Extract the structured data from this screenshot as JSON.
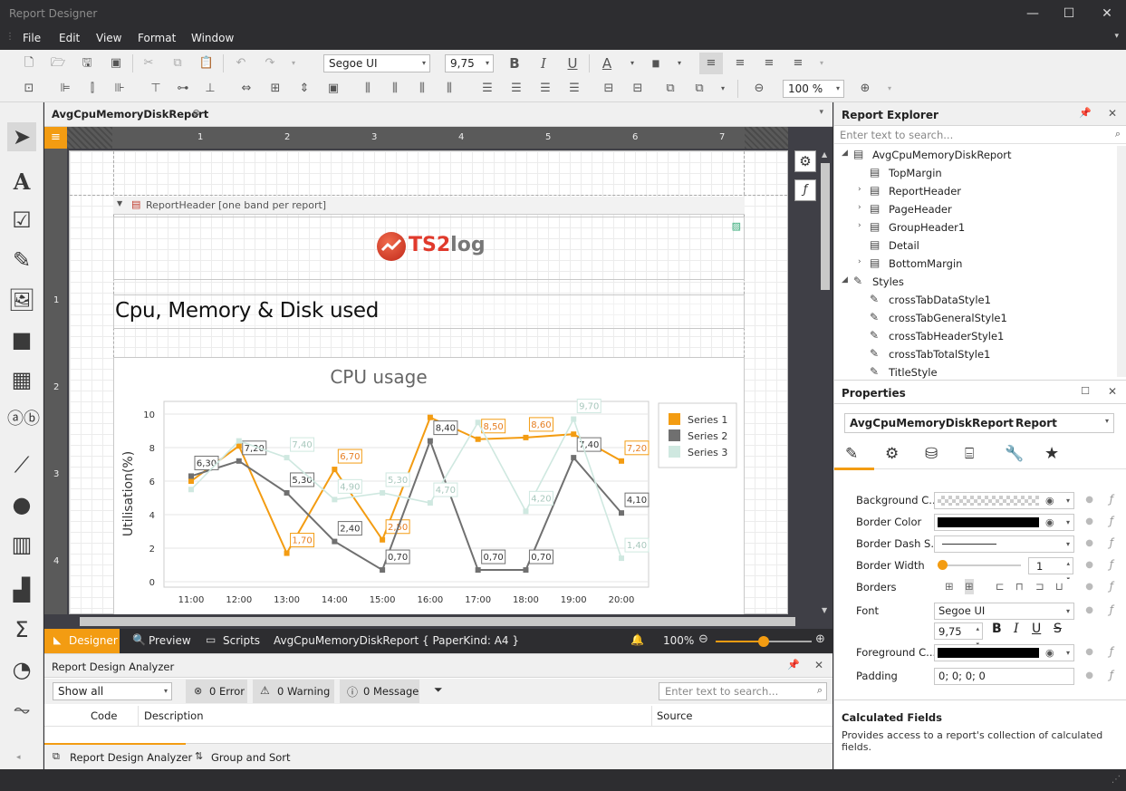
{
  "window": {
    "title": "Report Designer",
    "minimize": "—",
    "maximize": "☐",
    "close": "✕"
  },
  "menu": [
    "File",
    "Edit",
    "View",
    "Format",
    "Window"
  ],
  "toolbar": {
    "font_name": "Segoe UI",
    "font_size": "9,75",
    "zoom": "100 %"
  },
  "doc_tab": "AvgCpuMemoryDiskReport",
  "ruler_marks": [
    "1",
    "2",
    "3",
    "4",
    "5",
    "6",
    "7"
  ],
  "vruler_marks": [
    "1",
    "2",
    "3",
    "4"
  ],
  "band_header": "ReportHeader [one band per report]",
  "logo_text": "TS2log",
  "report_title": "Cpu, Memory & Disk used",
  "chart_data": {
    "type": "line",
    "title": "CPU usage",
    "ylabel": "Utilisation(%)",
    "xlabel": "",
    "categories": [
      "11:00",
      "12:00",
      "13:00",
      "14:00",
      "15:00",
      "16:00",
      "17:00",
      "18:00",
      "19:00",
      "20:00"
    ],
    "yticks": [
      "0",
      "2",
      "4",
      "6",
      "8",
      "10"
    ],
    "ylim": [
      0,
      10
    ],
    "legend": "top-right",
    "series": [
      {
        "name": "Series 1",
        "color": "#f39c12",
        "points": [
          [
            0,
            6.0
          ],
          [
            1,
            8.1
          ],
          [
            2,
            1.7
          ],
          [
            3,
            6.7
          ],
          [
            4,
            2.5
          ],
          [
            5,
            9.8
          ],
          [
            6,
            8.5
          ],
          [
            7,
            8.6
          ],
          [
            8,
            8.8
          ],
          [
            9,
            7.2
          ]
        ],
        "labels": [
          {
            "i": 2,
            "text": "1,70"
          },
          {
            "i": 3,
            "text": "6,70"
          },
          {
            "i": 4,
            "text": "2,50"
          },
          {
            "i": 6,
            "text": "8,50"
          },
          {
            "i": 7,
            "text": "8,60"
          },
          {
            "i": 9,
            "text": "7,20"
          }
        ]
      },
      {
        "name": "Series 2",
        "color": "#707070",
        "points": [
          [
            0,
            6.3
          ],
          [
            1,
            7.2
          ],
          [
            2,
            5.3
          ],
          [
            3,
            2.4
          ],
          [
            4,
            0.7
          ],
          [
            5,
            8.4
          ],
          [
            6,
            0.7
          ],
          [
            7,
            0.7
          ],
          [
            8,
            7.4
          ],
          [
            9,
            4.1
          ]
        ],
        "labels": [
          {
            "i": 0,
            "text": "6,30"
          },
          {
            "i": 1,
            "text": "7,20"
          },
          {
            "i": 2,
            "text": "5,30"
          },
          {
            "i": 3,
            "text": "2,40"
          },
          {
            "i": 4,
            "text": "0,70"
          },
          {
            "i": 5,
            "text": "8,40"
          },
          {
            "i": 6,
            "text": "0,70"
          },
          {
            "i": 7,
            "text": "0,70"
          },
          {
            "i": 8,
            "text": "7,40"
          },
          {
            "i": 9,
            "text": "4,10"
          }
        ]
      },
      {
        "name": "Series 3",
        "color": "#cfe8e0",
        "points": [
          [
            0,
            5.5
          ],
          [
            1,
            8.4
          ],
          [
            2,
            7.4
          ],
          [
            3,
            4.9
          ],
          [
            4,
            5.3
          ],
          [
            5,
            4.7
          ],
          [
            6,
            9.5
          ],
          [
            7,
            4.2
          ],
          [
            8,
            9.7
          ],
          [
            9,
            1.4
          ]
        ],
        "labels": [
          {
            "i": 2,
            "text": "7,40"
          },
          {
            "i": 3,
            "text": "4,90"
          },
          {
            "i": 4,
            "text": "5,30"
          },
          {
            "i": 5,
            "text": "4,70"
          },
          {
            "i": 7,
            "text": "4,20"
          },
          {
            "i": 8,
            "text": "9,70"
          },
          {
            "i": 9,
            "text": "1,40"
          }
        ]
      }
    ]
  },
  "bottom_tabs": {
    "designer": "Designer",
    "preview": "Preview",
    "scripts": "Scripts",
    "info": "AvgCpuMemoryDiskReport { PaperKind: A4 }",
    "zoom": "100%"
  },
  "analyzer": {
    "title": "Report Design Analyzer",
    "filter": "Show all",
    "errors": "0 Error",
    "warnings": "0 Warning",
    "messages": "0 Message",
    "search_placeholder": "Enter text to search...",
    "columns": [
      "Code",
      "Description",
      "Source"
    ],
    "tab1": "Report Design Analyzer",
    "tab2": "Group and Sort"
  },
  "explorer": {
    "title": "Report Explorer",
    "search_placeholder": "Enter text to search...",
    "items": [
      {
        "label": "AvgCpuMemoryDiskReport",
        "level": 0,
        "exp": "◢"
      },
      {
        "label": "TopMargin",
        "level": 1,
        "exp": ""
      },
      {
        "label": "ReportHeader",
        "level": 1,
        "exp": "›"
      },
      {
        "label": "PageHeader",
        "level": 1,
        "exp": "›"
      },
      {
        "label": "GroupHeader1",
        "level": 1,
        "exp": "›"
      },
      {
        "label": "Detail",
        "level": 1,
        "exp": ""
      },
      {
        "label": "BottomMargin",
        "level": 1,
        "exp": "›"
      },
      {
        "label": "Styles",
        "level": 0,
        "exp": "◢"
      },
      {
        "label": "crossTabDataStyle1",
        "level": 1,
        "exp": ""
      },
      {
        "label": "crossTabGeneralStyle1",
        "level": 1,
        "exp": ""
      },
      {
        "label": "crossTabHeaderStyle1",
        "level": 1,
        "exp": ""
      },
      {
        "label": "crossTabTotalStyle1",
        "level": 1,
        "exp": ""
      },
      {
        "label": "TitleStyle",
        "level": 1,
        "exp": ""
      }
    ]
  },
  "properties": {
    "title": "Properties",
    "object_name": "AvgCpuMemoryDiskReport",
    "object_type": "Report",
    "rows": [
      {
        "label": "Background C...",
        "kind": "checker"
      },
      {
        "label": "Border Color",
        "kind": "black"
      },
      {
        "label": "Border Dash S...",
        "kind": "dash"
      },
      {
        "label": "Border Width",
        "kind": "slider",
        "value": "1"
      },
      {
        "label": "Borders",
        "kind": "borders"
      },
      {
        "label": "Font",
        "kind": "combo",
        "value": "Segoe UI"
      },
      {
        "label": "",
        "kind": "fontsize",
        "value": "9,75"
      },
      {
        "label": "Foreground C...",
        "kind": "black"
      },
      {
        "label": "Padding",
        "kind": "text",
        "value": "0; 0; 0; 0"
      }
    ],
    "calc_title": "Calculated Fields",
    "calc_desc": "Provides access to a report's collection of calculated fields."
  }
}
